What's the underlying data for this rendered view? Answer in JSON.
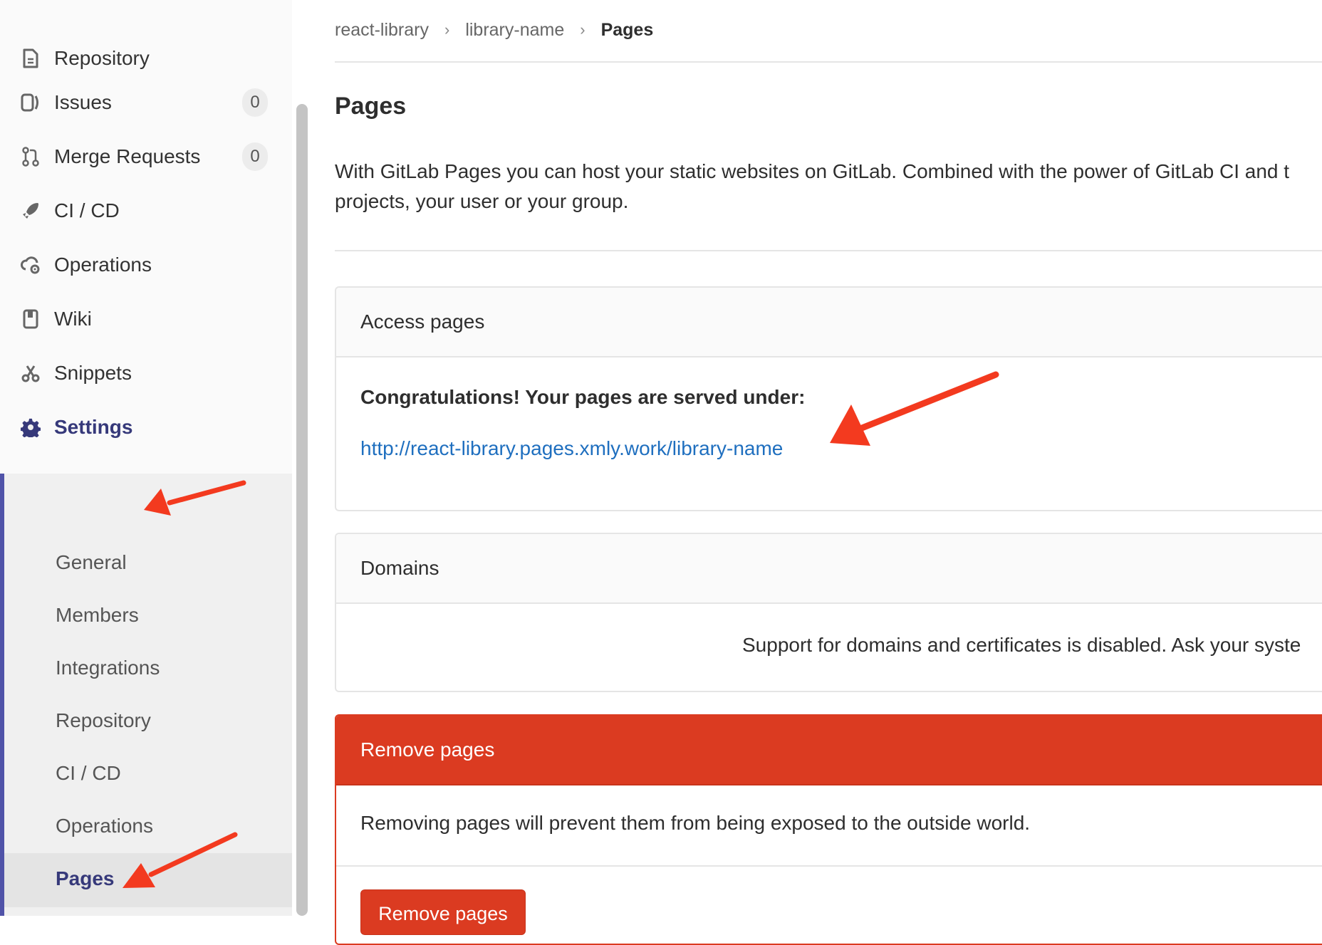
{
  "sidebar": {
    "items": [
      {
        "label": "Repository",
        "icon": "document-icon"
      },
      {
        "label": "Issues",
        "icon": "issues-icon",
        "badge": "0"
      },
      {
        "label": "Merge Requests",
        "icon": "merge-request-icon",
        "badge": "0"
      },
      {
        "label": "CI / CD",
        "icon": "rocket-icon"
      },
      {
        "label": "Operations",
        "icon": "cloud-gear-icon"
      },
      {
        "label": "Wiki",
        "icon": "book-icon"
      },
      {
        "label": "Snippets",
        "icon": "scissors-icon"
      },
      {
        "label": "Settings",
        "icon": "gear-icon"
      }
    ],
    "settings_sub": [
      "General",
      "Members",
      "Integrations",
      "Repository",
      "CI / CD",
      "Operations",
      "Pages"
    ],
    "active_sub": "Pages"
  },
  "breadcrumb": {
    "items": [
      "react-library",
      "library-name",
      "Pages"
    ]
  },
  "page": {
    "title": "Pages",
    "intro_line1": "With GitLab Pages you can host your static websites on GitLab. Combined with the power of GitLab CI and t",
    "intro_line2": "projects, your user or your group."
  },
  "access_panel": {
    "title": "Access pages",
    "congrats": "Congratulations! Your pages are served under:",
    "url": "http://react-library.pages.xmly.work/library-name"
  },
  "domains_panel": {
    "title": "Domains",
    "message": "Support for domains and certificates is disabled. Ask your syste"
  },
  "remove_panel": {
    "title": "Remove pages",
    "message": "Removing pages will prevent them from being exposed to the outside world.",
    "button": "Remove pages"
  },
  "colors": {
    "accent": "#5053a8",
    "danger": "#db3b21",
    "link": "#1f6fbf",
    "annotation_arrow": "#f33a1f"
  }
}
